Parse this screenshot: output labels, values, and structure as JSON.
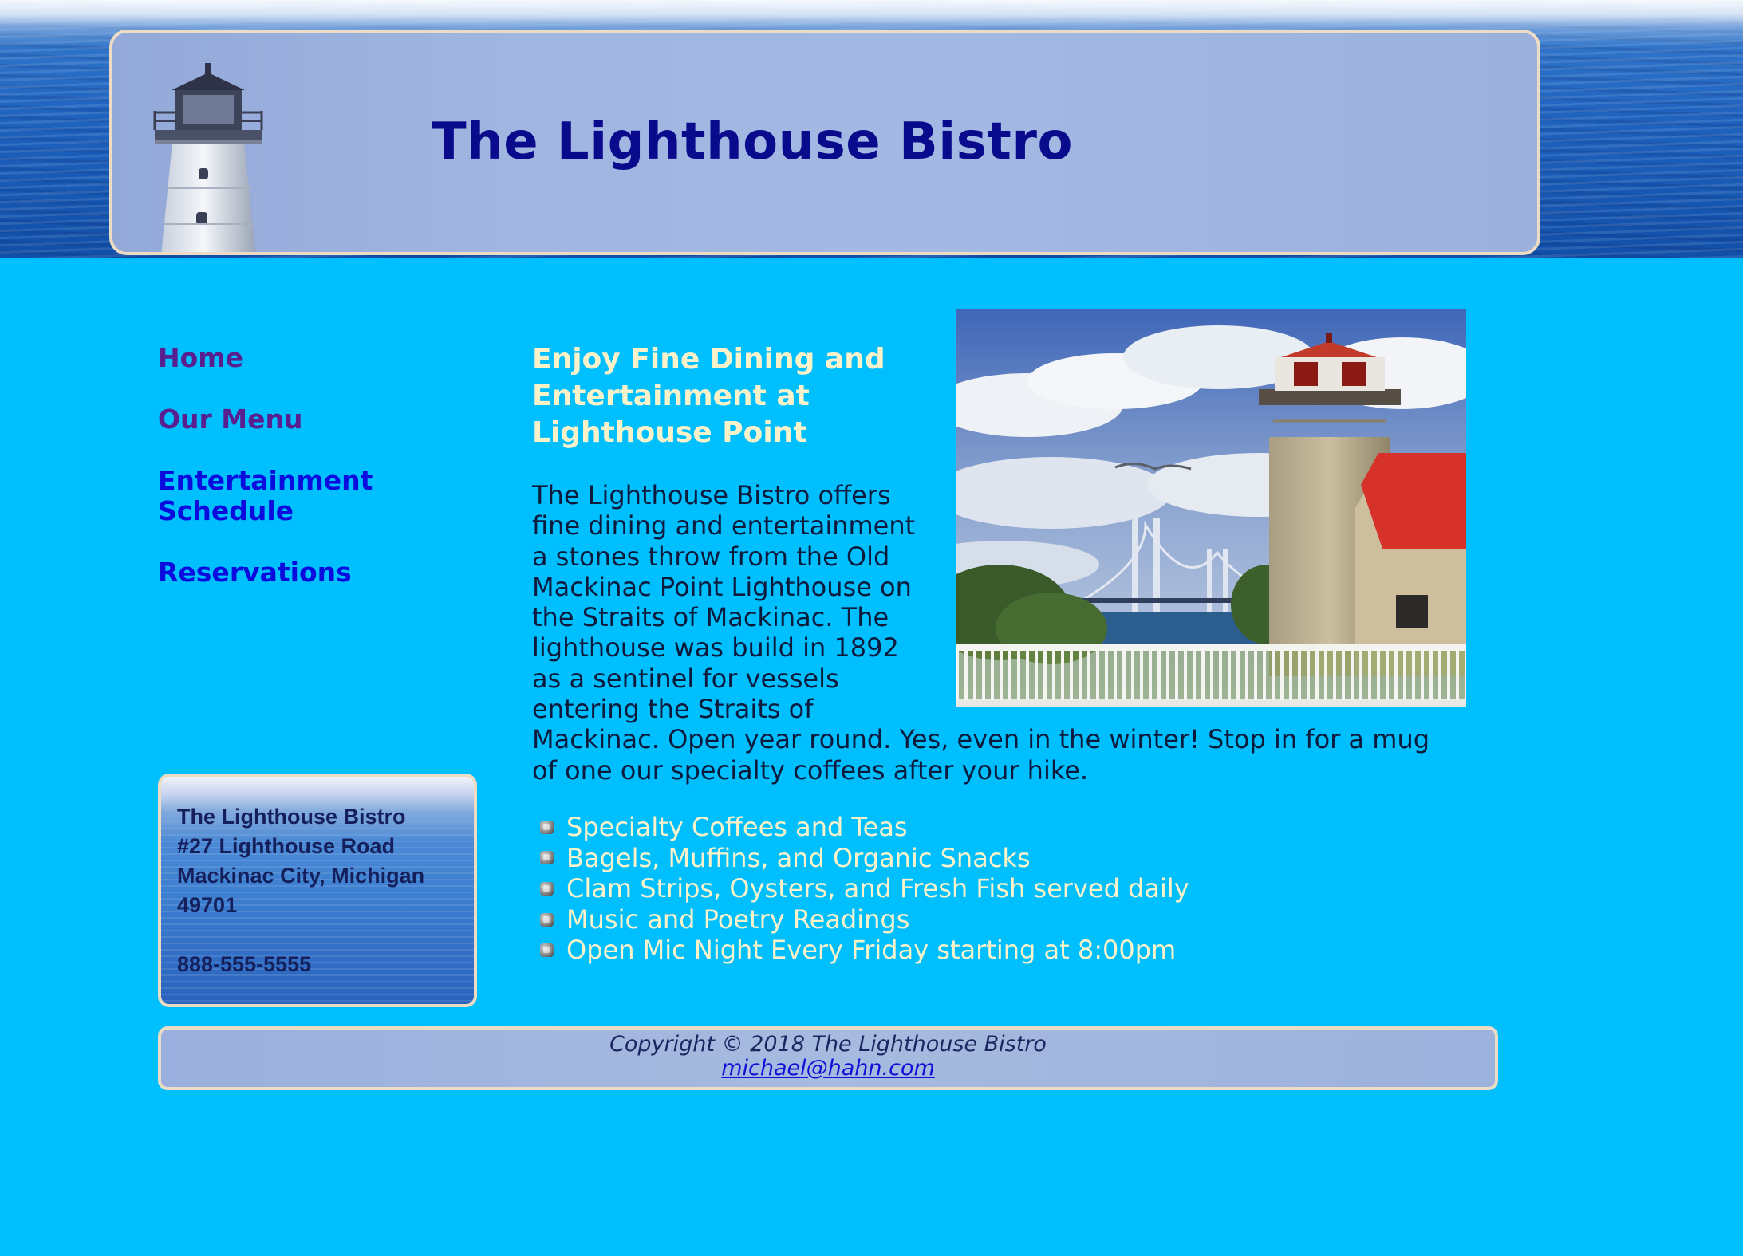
{
  "site": {
    "title": "The Lighthouse Bistro"
  },
  "nav": {
    "items": [
      {
        "label": "Home",
        "state": "visited"
      },
      {
        "label": "Our Menu",
        "state": "visited"
      },
      {
        "label": "Entertainment Schedule",
        "state": "unvisited"
      },
      {
        "label": "Reservations",
        "state": "unvisited"
      }
    ]
  },
  "address": {
    "name": "The Lighthouse Bistro",
    "street": "#27 Lighthouse Road",
    "city": "Mackinac City, Michigan",
    "zip": "49701",
    "phone": "888-555-5555"
  },
  "main": {
    "heading_lines": [
      "Enjoy Fine Dining and",
      "Entertainment at",
      "Lighthouse Point"
    ],
    "intro_lines": [
      "The Lighthouse Bistro offers",
      "fine dining and entertainment",
      "a stones throw from the Old",
      "Mackinac Point Lighthouse on",
      "the Straits of Mackinac. The",
      "lighthouse was build in 1892",
      "as a sentinel for vessels",
      "entering the Straits of",
      "Mackinac. Open year round. Yes, even in the winter! Stop in for a mug",
      "of one our specialty coffees after your hike."
    ],
    "features": [
      "Specialty Coffees and Teas",
      "Bagels, Muffins, and Organic Snacks",
      "Clam Strips, Oysters, and Fresh Fish served daily",
      "Music and Poetry Readings",
      "Open Mic Night Every Friday starting at 8:00pm"
    ]
  },
  "footer": {
    "copyright": "Copyright © 2018 The Lighthouse Bistro",
    "email": "michael@hahn.com"
  },
  "colors": {
    "page_background": "#00bfff",
    "title": "#0a0a8c",
    "heading": "#fbf2c9",
    "nav_visited": "#5a1f8f",
    "nav_link": "#0b0bde",
    "box_border": "#ecdcc4"
  }
}
